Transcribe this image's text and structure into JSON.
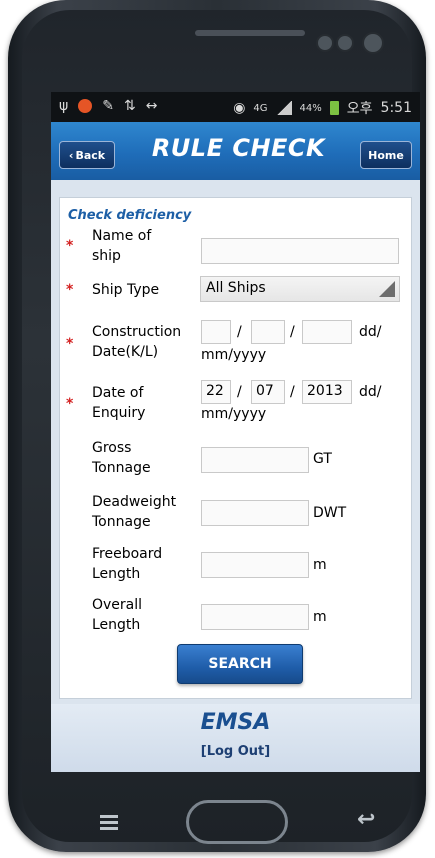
{
  "statusbar": {
    "left_icons": [
      "usb-icon",
      "app-notify-icon",
      "tool-icon",
      "sync-icon",
      "arrows-icon"
    ],
    "signal_label": "4G",
    "battery": "44%",
    "time_prefix": "오후",
    "time": "5:51"
  },
  "header": {
    "back_label": "Back",
    "title": "RULE CHECK",
    "home_label": "Home"
  },
  "form": {
    "section_title": "Check deficiency",
    "name_of_ship": {
      "label_line1": "Name of",
      "label_line2": "ship",
      "value": ""
    },
    "ship_type": {
      "label": "Ship Type",
      "value": "All Ships"
    },
    "construction_date": {
      "label_line1": "Construction",
      "label_line2": "Date(K/L)",
      "day": "",
      "month": "",
      "year": "",
      "separator": "/",
      "format_line1": "dd/",
      "format_line2": "mm/yyyy"
    },
    "date_of_enquiry": {
      "label_line1": "Date of",
      "label_line2": "Enquiry",
      "day": "22",
      "month": "07",
      "year": "2013",
      "separator": "/",
      "format_line1": "dd/",
      "format_line2": "mm/yyyy"
    },
    "gross_tonnage": {
      "label_line1": "Gross",
      "label_line2": "Tonnage",
      "value": "",
      "unit": "GT"
    },
    "deadweight_tonnage": {
      "label_line1": "Deadweight",
      "label_line2": "Tonnage",
      "value": "",
      "unit": "DWT"
    },
    "freeboard_length": {
      "label_line1": "Freeboard",
      "label_line2": "Length",
      "value": "",
      "unit": "m"
    },
    "overall_length": {
      "label_line1": "Overall",
      "label_line2": "Length",
      "value": "",
      "unit": "m"
    },
    "required_marker": "*",
    "search_label": "SEARCH"
  },
  "footer": {
    "brand": "EMSA",
    "logout": "[Log Out]"
  },
  "colors": {
    "titlebar": "#1f6db9",
    "brand_text": "#1a4f90",
    "required": "#d32020"
  }
}
